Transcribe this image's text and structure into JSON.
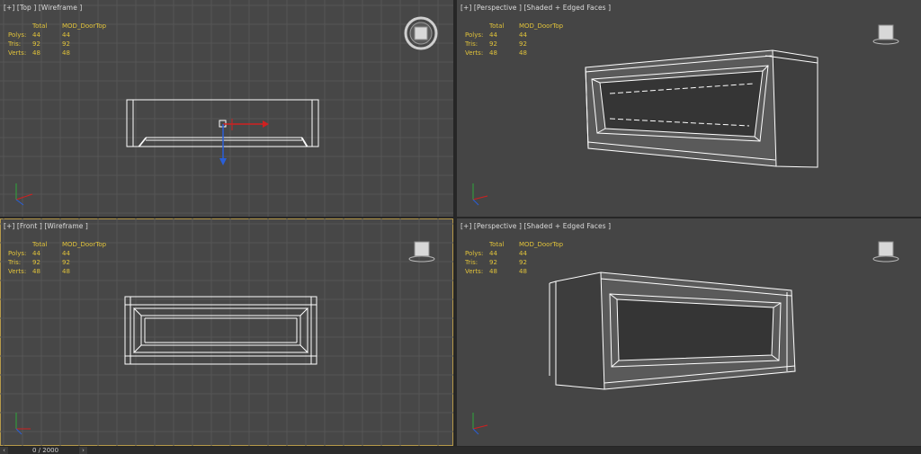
{
  "viewports": [
    {
      "label": "[+] [Top ] [Wireframe ]",
      "navigator": "viewcube"
    },
    {
      "label": "[+] [Perspective ] [Shaded + Edged Faces ]",
      "navigator": "viewcube"
    },
    {
      "label": "[+] [Front ] [Wireframe ]",
      "navigator": "viewcube"
    },
    {
      "label": "[+] [Perspective ] [Shaded + Edged Faces ]",
      "navigator": "viewcube"
    }
  ],
  "stats": {
    "header_total": "Total",
    "header_object": "MOD_DoorTop",
    "rows": [
      {
        "label": "Polys:",
        "total": "44",
        "object": "44"
      },
      {
        "label": "Tris:",
        "total": "92",
        "object": "92"
      },
      {
        "label": "Verts:",
        "total": "48",
        "object": "48"
      }
    ]
  },
  "timeline": {
    "frame": "0 / 2000",
    "prev_icon": "chevron-left-icon",
    "next_icon": "chevron-right-icon"
  },
  "colors": {
    "stats_text": "#e0c23a",
    "active_border": "#b79a4a",
    "wire": "#ffffff",
    "grid": "#565656",
    "gizmo_x": "#d02020",
    "gizmo_y": "#2a5fd8",
    "gizmo_z": "#2ea83a"
  }
}
